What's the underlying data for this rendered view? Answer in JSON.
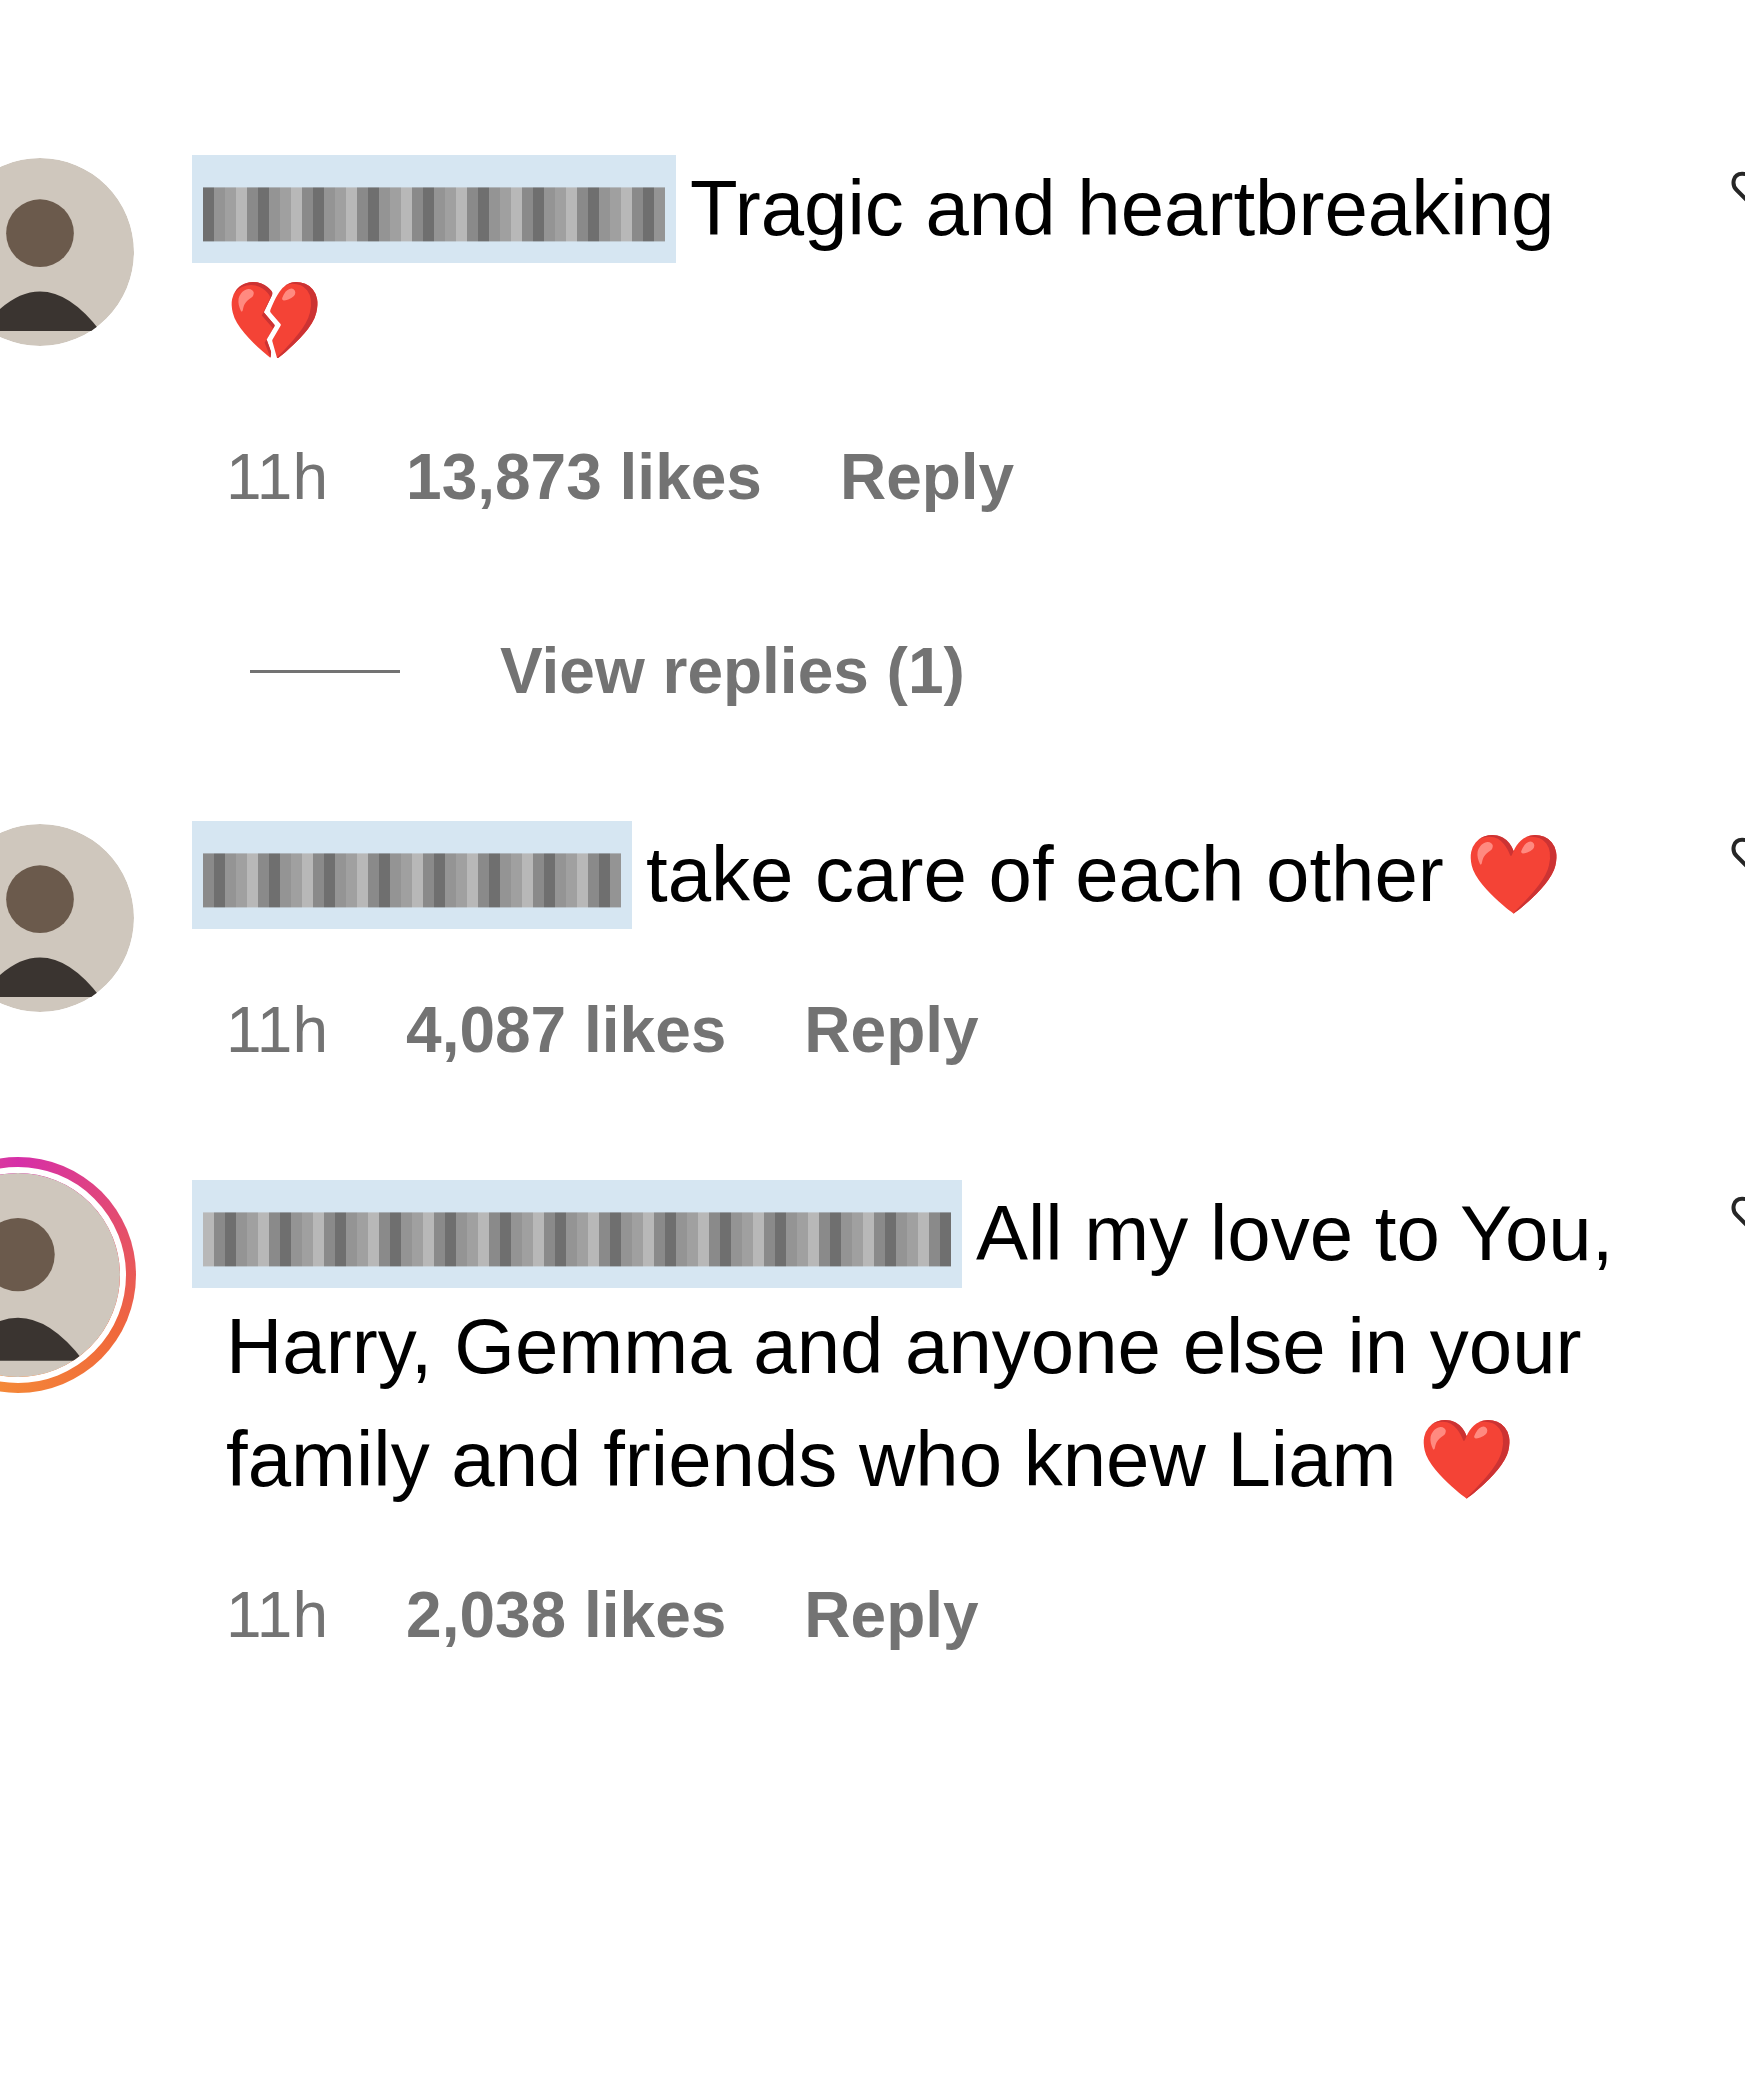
{
  "comments": [
    {
      "author_redacted": true,
      "avatar": {
        "story_ring": false
      },
      "text": "Tragic and heartbreaking 💔",
      "time": "11h",
      "likes": "13,873 likes",
      "reply": "Reply",
      "view_replies": "View replies (1)"
    },
    {
      "author_redacted": true,
      "avatar": {
        "story_ring": false
      },
      "text": "take care of each other ❤️",
      "time": "11h",
      "likes": "4,087 likes",
      "reply": "Reply"
    },
    {
      "author_redacted": true,
      "avatar": {
        "story_ring": true
      },
      "text": "All my love to You, Harry, Gemma and anyone else in your family and friends who knew Liam ❤️",
      "time": "11h",
      "likes": "2,038 likes",
      "reply": "Reply"
    }
  ]
}
